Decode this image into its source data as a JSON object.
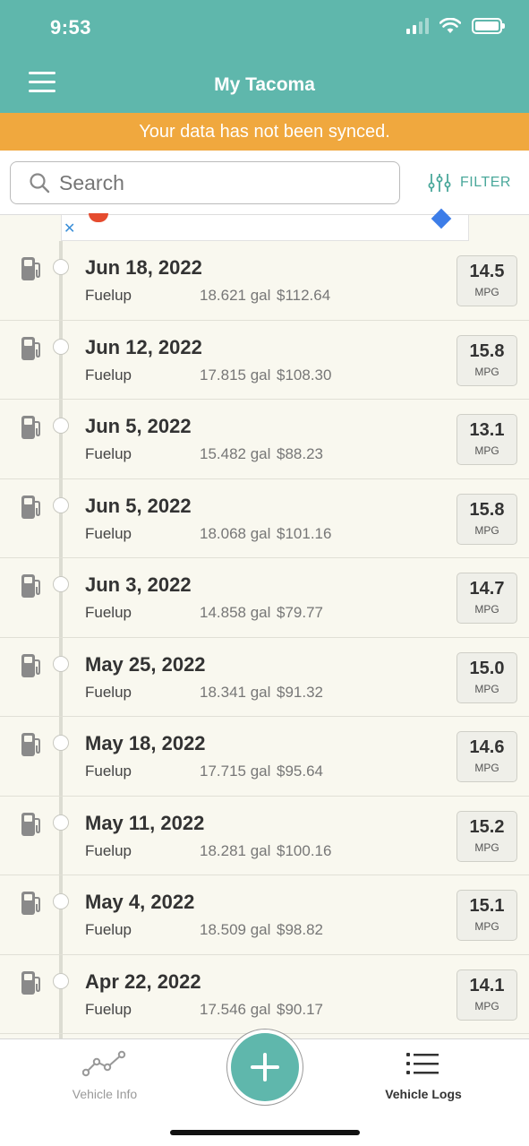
{
  "status_bar": {
    "time": "9:53"
  },
  "header": {
    "title": "My Tacoma"
  },
  "sync_banner": {
    "text": "Your data has not been synced."
  },
  "search": {
    "placeholder": "Search",
    "filter_label": "FILTER"
  },
  "colors": {
    "primary": "#5fb7ac",
    "warning": "#f0a83e",
    "background": "#f9f8ef"
  },
  "mpg_unit": "MPG",
  "logs": [
    {
      "date": "Jun 18, 2022",
      "type": "Fuelup",
      "gallons": "18.621 gal",
      "cost": "$112.64",
      "mpg": "14.5"
    },
    {
      "date": "Jun 12, 2022",
      "type": "Fuelup",
      "gallons": "17.815 gal",
      "cost": "$108.30",
      "mpg": "15.8"
    },
    {
      "date": "Jun 5, 2022",
      "type": "Fuelup",
      "gallons": "15.482 gal",
      "cost": "$88.23",
      "mpg": "13.1"
    },
    {
      "date": "Jun 5, 2022",
      "type": "Fuelup",
      "gallons": "18.068 gal",
      "cost": "$101.16",
      "mpg": "15.8"
    },
    {
      "date": "Jun 3, 2022",
      "type": "Fuelup",
      "gallons": "14.858 gal",
      "cost": "$79.77",
      "mpg": "14.7"
    },
    {
      "date": "May 25, 2022",
      "type": "Fuelup",
      "gallons": "18.341 gal",
      "cost": "$91.32",
      "mpg": "15.0"
    },
    {
      "date": "May 18, 2022",
      "type": "Fuelup",
      "gallons": "17.715 gal",
      "cost": "$95.64",
      "mpg": "14.6"
    },
    {
      "date": "May 11, 2022",
      "type": "Fuelup",
      "gallons": "18.281 gal",
      "cost": "$100.16",
      "mpg": "15.2"
    },
    {
      "date": "May 4, 2022",
      "type": "Fuelup",
      "gallons": "18.509 gal",
      "cost": "$98.82",
      "mpg": "15.1"
    },
    {
      "date": "Apr 22, 2022",
      "type": "Fuelup",
      "gallons": "17.546 gal",
      "cost": "$90.17",
      "mpg": "14.1"
    }
  ],
  "bottom_nav": {
    "vehicle_info": {
      "label": "Vehicle Info",
      "icon": "line-chart-icon"
    },
    "add": {
      "icon": "plus-icon"
    },
    "vehicle_logs": {
      "label": "Vehicle Logs",
      "icon": "list-icon"
    }
  }
}
